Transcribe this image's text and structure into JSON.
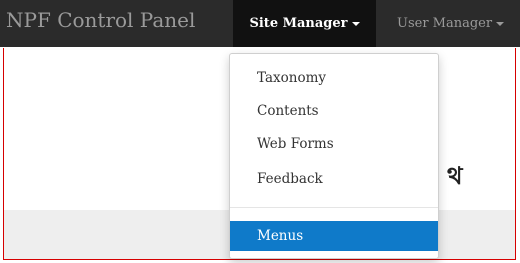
{
  "navbar": {
    "brand": "NPF Control Panel",
    "items": [
      {
        "label": "Site Manager",
        "active": true
      },
      {
        "label": "User Manager",
        "active": false
      }
    ]
  },
  "dropdown": {
    "items": [
      "Taxonomy",
      "Contents",
      "Web Forms",
      "Feedback"
    ],
    "active_item": "Menus",
    "active_color": "#0f7ac9"
  },
  "content": {
    "partial_heading": "থ"
  }
}
